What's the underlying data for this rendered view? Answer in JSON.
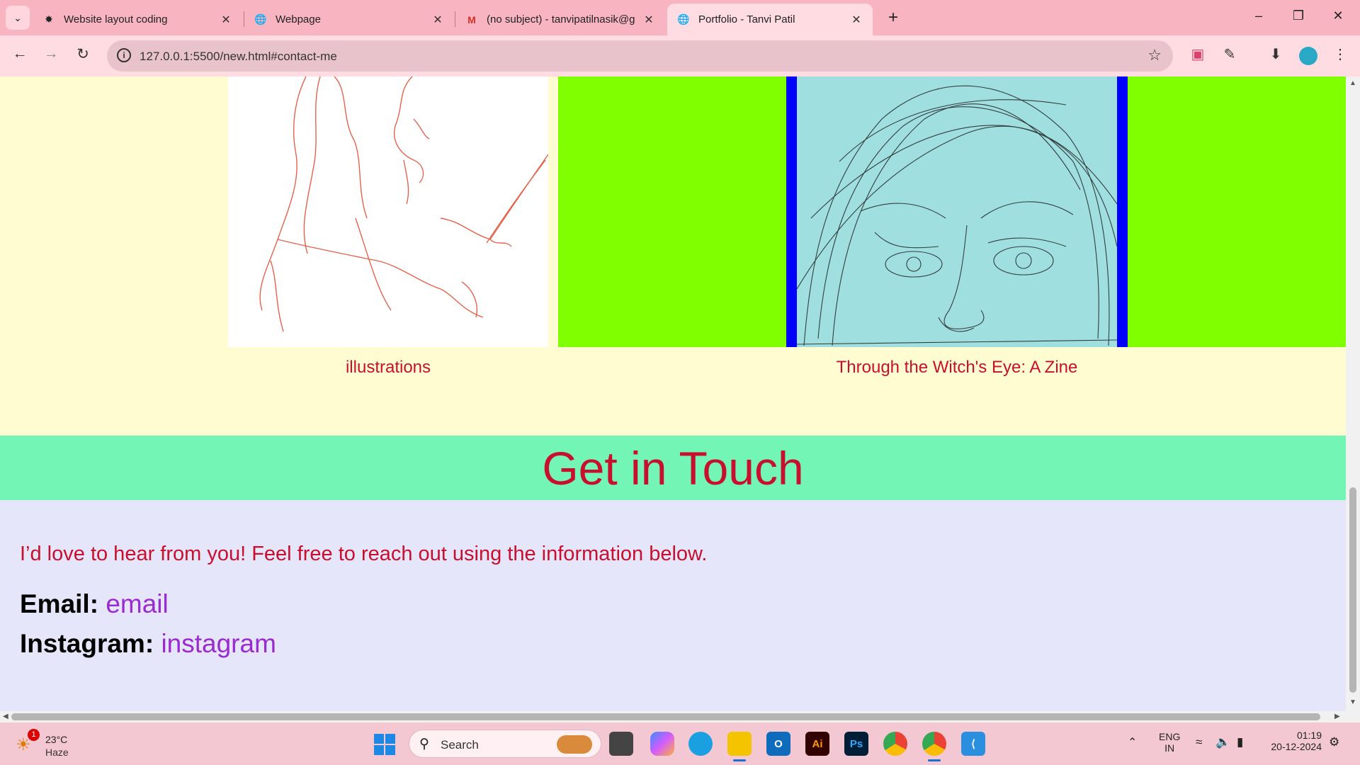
{
  "browser": {
    "tabs": [
      {
        "title": "Website layout coding",
        "favicon": "chatgpt-icon",
        "active": false
      },
      {
        "title": "Webpage",
        "favicon": "globe-icon",
        "active": false
      },
      {
        "title": "(no subject) - tanvipatilnasik@g",
        "favicon": "gmail-icon",
        "active": false
      },
      {
        "title": "Portfolio - Tanvi Patil",
        "favicon": "globe-icon",
        "active": true
      }
    ],
    "url": "127.0.0.1:5500/new.html#contact-me"
  },
  "page": {
    "projects": [
      {
        "caption": "illustrations",
        "image": "red-pencil-sketch-of-woman-reading"
      },
      {
        "caption": "Through the Witch's Eye: A Zine",
        "image": "pencil-sketch-face-with-wide-eyes"
      }
    ],
    "contact": {
      "heading": "Get in Touch",
      "intro": "I’d love to hear from you! Feel free to reach out using the information below.",
      "email_label": "Email:",
      "email_link": "email",
      "instagram_label": "Instagram:",
      "instagram_link": "instagram"
    },
    "colors": {
      "projects_bg": "#fffcd2",
      "zine_bg": "#80ff00",
      "zine_frame": "#0000ff",
      "contact_header_bg": "#73f5b6",
      "contact_body_bg": "#e6e6fb",
      "text_red": "#c8102e",
      "link_purple": "#9a2bd0"
    }
  },
  "taskbar": {
    "weather": {
      "temp": "23°C",
      "condition": "Haze",
      "badge": "1"
    },
    "search_label": "Search",
    "language": {
      "line1": "ENG",
      "line2": "IN"
    },
    "time": "01:19",
    "date": "20-12-2024"
  }
}
